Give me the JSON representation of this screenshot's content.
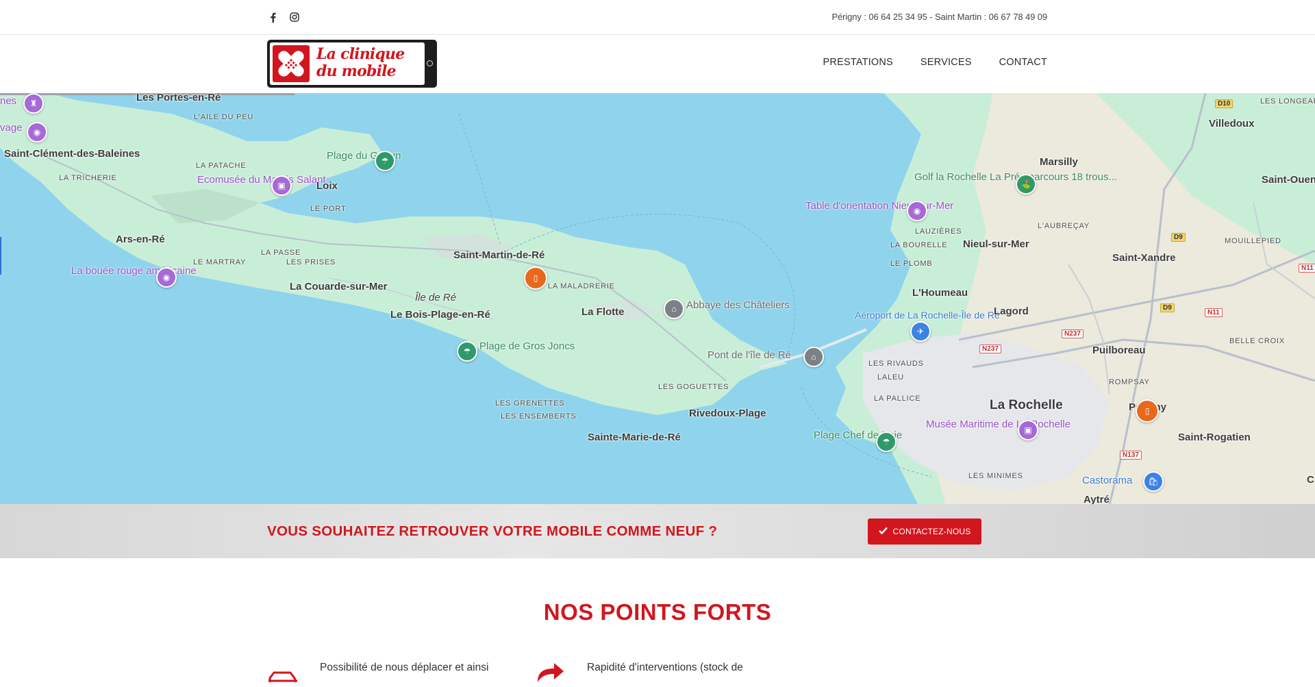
{
  "topbar": {
    "phones": "Périgny : 06 64 25 34 95 - Saint Martin : 06 67 78 49 09",
    "social": [
      "facebook-icon",
      "instagram-icon"
    ]
  },
  "header": {
    "logo_line1": "La clinique",
    "logo_line2": "du mobile",
    "nav": [
      "PRESTATIONS",
      "SERVICES",
      "CONTACT"
    ]
  },
  "map": {
    "labels": {
      "portes": "Les Portes-en-Ré",
      "aile": "L'AILE DU PEU",
      "clement": "Saint-Clément-des-Baleines",
      "tricherie": "LA TRICHERIE",
      "patache": "LA PATACHE",
      "ecomusee": "Ecomusée du Marais Salant",
      "loix": "Loix",
      "port": "LE PORT",
      "grouin": "Plage du Grouin",
      "ars": "Ars-en-Ré",
      "passe": "LA PASSE",
      "prises": "LES PRISES",
      "martray": "LE MARTRAY",
      "bouee": "La bouée rouge américaine",
      "couarde": "La Couarde-sur-Mer",
      "ile": "Île de Ré",
      "bois": "Le Bois-Plage-en-Ré",
      "smartin": "Saint-Martin-de-Ré",
      "maladrerie": "LA MALADRERIE",
      "flotte": "La Flotte",
      "abbaye": "Abbaye des Châteliers",
      "grosjoncs": "Plage de Gros Joncs",
      "grenettes": "LES GRENETTES",
      "ensemberts": "LES ENSEMBERTS",
      "goguettes": "LES GOGUETTES",
      "rivedoux": "Rivedoux-Plage",
      "smarie": "Sainte-Marie-de-Ré",
      "pont": "Pont de l'île de Ré",
      "marsilly": "Marsilly",
      "villedoux": "Villedoux",
      "golf": "Golf la Rochelle La Prée parcours 18 trous...",
      "table": "Table d'orientation Nieul-sur-Mer",
      "lauzieres": "LAUZIÈRES",
      "aubreçay": "L'AUBREÇAY",
      "bourelle": "LA BOURELLE",
      "nieul": "Nieul-sur-Mer",
      "plomb": "LE PLOMB",
      "sxandre": "Saint-Xandre",
      "mouillepied": "MOUILLEPIED",
      "souen": "Saint-Ouen",
      "longeard": "LES LONGEAR",
      "houmeau": "L'Houmeau",
      "aeroport": "Aéroport de La Rochelle-Île de Ré",
      "lagord": "Lagord",
      "rivauds": "LES RIVAUDS",
      "laleu": "LALEU",
      "puilboreau": "Puilboreau",
      "bellecroix": "BELLE CROIX",
      "rompsay": "ROMPSAY",
      "pallice": "LA PALLICE",
      "larochelle": "La Rochelle",
      "perigny": "Périgny",
      "musee": "Musée Maritime de La Rochelle",
      "chefbaie": "Plage Chef de Baie",
      "srogatien": "Saint-Rogatien",
      "minimes": "LES MINIMES",
      "castorama": "Castorama",
      "aytre": "Aytré",
      "nes": "nes",
      "vage": "vage",
      "c": "C"
    },
    "roads": {
      "d10": "D10",
      "d9a": "D9",
      "d9b": "D9",
      "n11a": "N11",
      "n11b": "N11",
      "n237a": "N237",
      "n237b": "N237",
      "n137": "N137"
    }
  },
  "cta": {
    "text": "VOUS SOUHAITEZ RETROUVER VOTRE MOBILE COMME NEUF ?",
    "button": "CONTACTEZ-NOUS"
  },
  "points_forts": {
    "title": "NOS POINTS FORTS",
    "items": [
      "Possibilité de nous déplacer et ainsi",
      "Rapidité d'interventions (stock de"
    ]
  },
  "colors": {
    "brand_red": "#d2161e",
    "water": "#8fd4ec",
    "land": "#c9eed8"
  }
}
